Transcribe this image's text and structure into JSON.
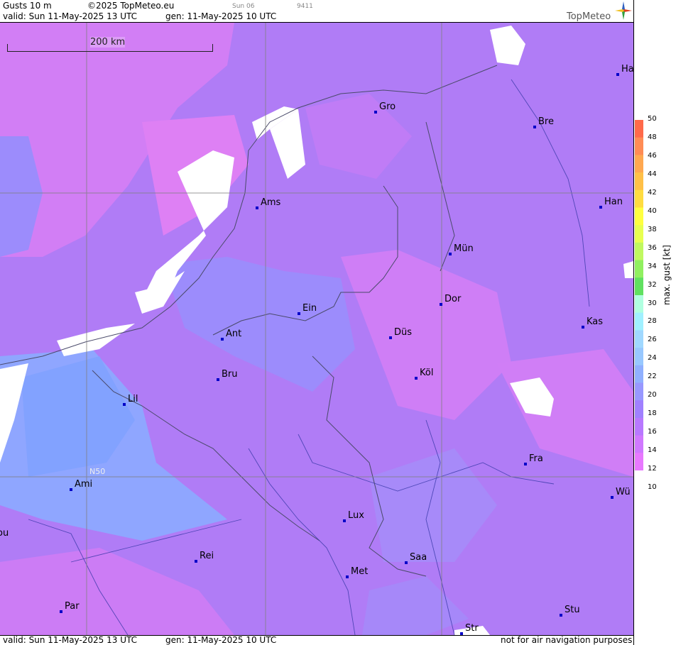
{
  "header": {
    "product": "Gusts 10 m",
    "copyright": "©2025 TopMeteo.eu",
    "run_small": "Sun 06",
    "id_small": "9411",
    "valid": "valid:  Sun  11-May-2025  13 UTC",
    "gen": "gen: 11-May-2025 10 UTC",
    "brand": "TopMeteo"
  },
  "footer": {
    "valid": "valid:  Sun  11-May-2025  13 UTC",
    "gen": "gen: 11-May-2025 10 UTC",
    "disclaimer": "not for air navigation purposes"
  },
  "scale_bar": "200 km",
  "grid_label": "N50",
  "legend": {
    "title": "max. gust [kt]",
    "ticks": [
      "50",
      "48",
      "46",
      "44",
      "42",
      "40",
      "38",
      "36",
      "34",
      "32",
      "30",
      "28",
      "26",
      "24",
      "22",
      "20",
      "18",
      "16",
      "14",
      "12",
      "10"
    ],
    "colors": [
      "#ff6a4a",
      "#ff8c55",
      "#ffa850",
      "#ffc048",
      "#ffdc40",
      "#ffff40",
      "#e8ff50",
      "#c0f860",
      "#90f060",
      "#60e060",
      "#b0ffe0",
      "#a0f0ff",
      "#a0d8ff",
      "#98c8ff",
      "#90b0ff",
      "#9898ff",
      "#a080ff",
      "#b878ff",
      "#d078ff",
      "#e878ff"
    ]
  },
  "cities": [
    {
      "name": "Gro"
    },
    {
      "name": "Bre"
    },
    {
      "name": "Ha"
    },
    {
      "name": "Ams"
    },
    {
      "name": "Han"
    },
    {
      "name": "Mün"
    },
    {
      "name": "Dor"
    },
    {
      "name": "Ein"
    },
    {
      "name": "Kas"
    },
    {
      "name": "Düs"
    },
    {
      "name": "Ant"
    },
    {
      "name": "Köl"
    },
    {
      "name": "Bru"
    },
    {
      "name": "Lil"
    },
    {
      "name": "Fra"
    },
    {
      "name": "Ami"
    },
    {
      "name": "Wü"
    },
    {
      "name": "ou"
    },
    {
      "name": "Lux"
    },
    {
      "name": "Rei"
    },
    {
      "name": "Saa"
    },
    {
      "name": "Met"
    },
    {
      "name": "Stu"
    },
    {
      "name": "Par"
    },
    {
      "name": "Str"
    }
  ]
}
